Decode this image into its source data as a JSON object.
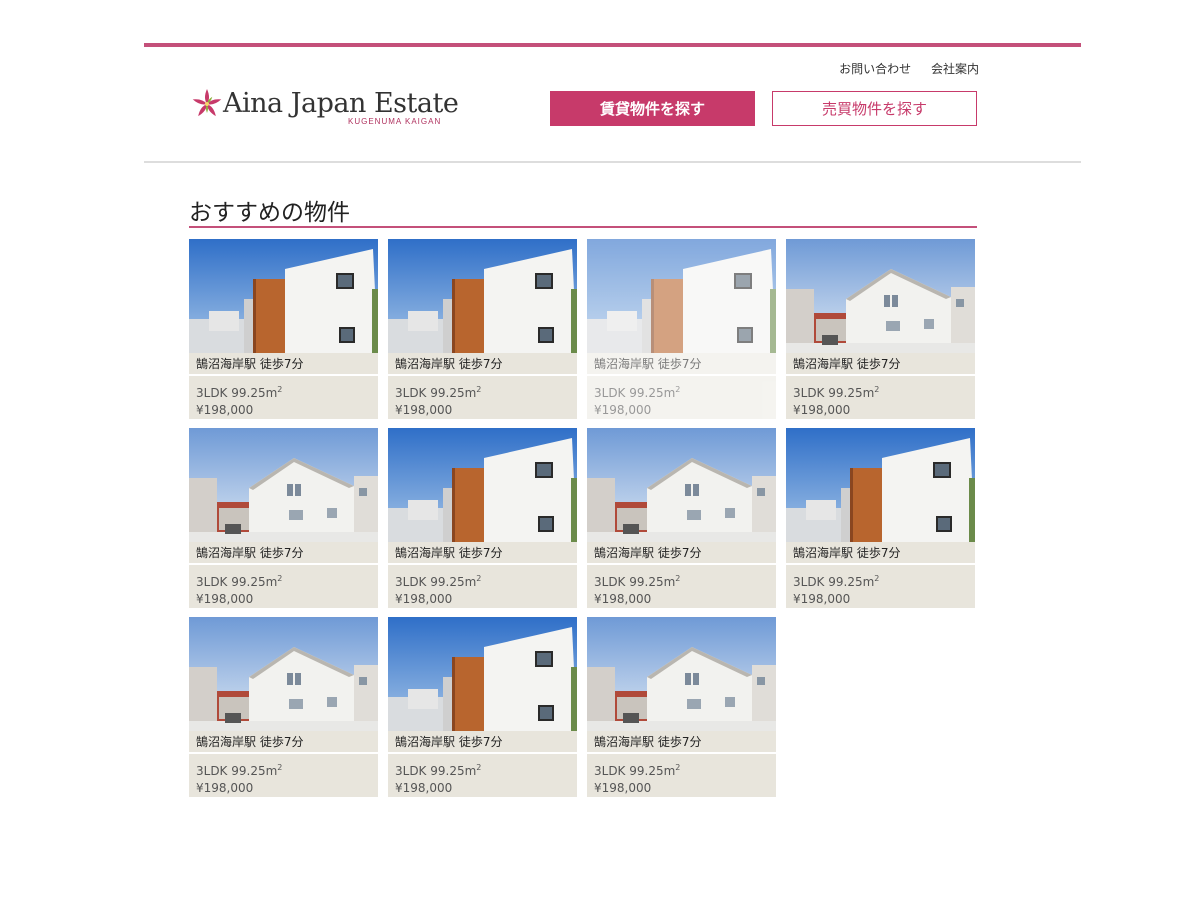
{
  "header": {
    "logo_text": "Aina Japan Estate",
    "logo_sub": "KUGENUMA KAIGAN",
    "links": [
      "お問い合わせ",
      "会社案内"
    ],
    "rent_button": "賃貸物件を探す",
    "sale_button": "売買物件を探す",
    "accent_color": "#c73a6a"
  },
  "section": {
    "title": "おすすめの物件"
  },
  "listings": [
    {
      "station": "鵠沼海岸駅 徒歩7分",
      "layout": "3LDK 99.25m",
      "sup": "2",
      "price": "¥198,000",
      "photo": "modern-house-icon"
    },
    {
      "station": "鵠沼海岸駅 徒歩7分",
      "layout": "3LDK 99.25m",
      "sup": "2",
      "price": "¥198,000",
      "photo": "modern-house-icon"
    },
    {
      "station": "鵠沼海岸駅 徒歩7分",
      "layout": "3LDK 99.25m",
      "sup": "2",
      "price": "¥198,000",
      "photo": "modern-house-icon"
    },
    {
      "station": "鵠沼海岸駅 徒歩7分",
      "layout": "3LDK 99.25m",
      "sup": "2",
      "price": "¥198,000",
      "photo": "white-house-icon"
    },
    {
      "station": "鵠沼海岸駅 徒歩7分",
      "layout": "3LDK 99.25m",
      "sup": "2",
      "price": "¥198,000",
      "photo": "white-house-icon"
    },
    {
      "station": "鵠沼海岸駅 徒歩7分",
      "layout": "3LDK 99.25m",
      "sup": "2",
      "price": "¥198,000",
      "photo": "modern-house-icon"
    },
    {
      "station": "鵠沼海岸駅 徒歩7分",
      "layout": "3LDK 99.25m",
      "sup": "2",
      "price": "¥198,000",
      "photo": "white-house-icon"
    },
    {
      "station": "鵠沼海岸駅 徒歩7分",
      "layout": "3LDK 99.25m",
      "sup": "2",
      "price": "¥198,000",
      "photo": "modern-house-icon"
    },
    {
      "station": "鵠沼海岸駅 徒歩7分",
      "layout": "3LDK 99.25m",
      "sup": "2",
      "price": "¥198,000",
      "photo": "white-house-icon"
    },
    {
      "station": "鵠沼海岸駅 徒歩7分",
      "layout": "3LDK 99.25m",
      "sup": "2",
      "price": "¥198,000",
      "photo": "modern-house-icon"
    },
    {
      "station": "鵠沼海岸駅 徒歩7分",
      "layout": "3LDK 99.25m",
      "sup": "2",
      "price": "¥198,000",
      "photo": "white-house-icon"
    }
  ]
}
